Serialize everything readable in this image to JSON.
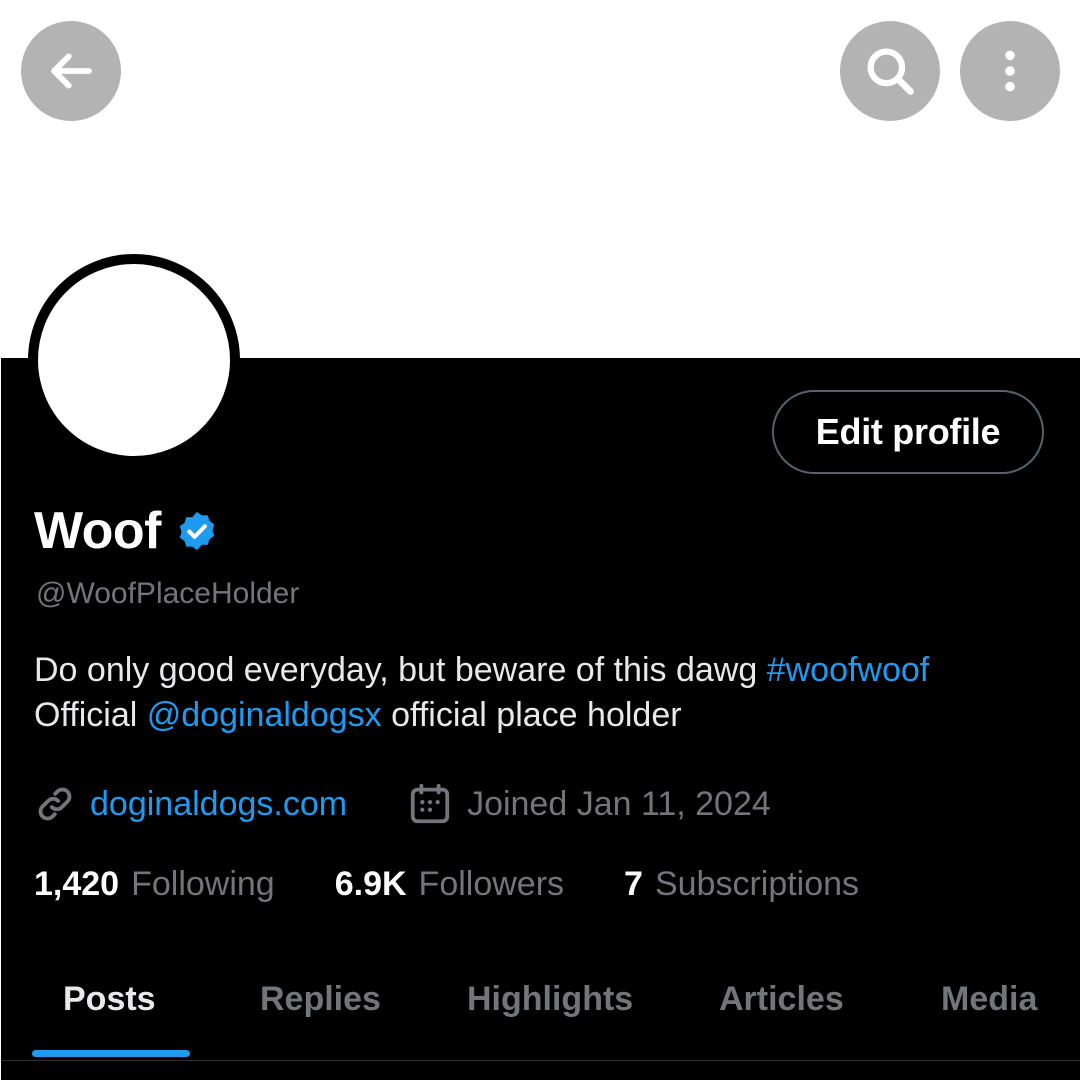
{
  "top_bar": {
    "back_icon": "arrow-left-icon",
    "search_icon": "search-icon",
    "more_icon": "more-vertical-icon"
  },
  "profile": {
    "display_name": "Woof",
    "verified_icon": "verified-badge-icon",
    "handle": "@WoofPlaceHolder",
    "edit_label": "Edit profile",
    "bio_line1_text": "Do only good everyday, but beware of this dawg ",
    "bio_hashtag": "#woofwoof",
    "bio_line2_prefix": "Official ",
    "bio_mention": "@doginaldogsx",
    "bio_line2_suffix": " official place holder",
    "website_icon": "link-icon",
    "website": "doginaldogs.com",
    "joined_icon": "calendar-icon",
    "joined": "Joined Jan 11, 2024"
  },
  "stats": [
    {
      "count": "1,420",
      "label": "Following"
    },
    {
      "count": "6.9K",
      "label": "Followers"
    },
    {
      "count": "7",
      "label": "Subscriptions"
    }
  ],
  "tabs": [
    {
      "label": "Posts",
      "active": true
    },
    {
      "label": "Replies",
      "active": false
    },
    {
      "label": "Highlights",
      "active": false
    },
    {
      "label": "Articles",
      "active": false
    },
    {
      "label": "Media",
      "active": false
    }
  ],
  "colors": {
    "accent": "#1d9bf0",
    "background": "#000000",
    "muted_text": "#71767b",
    "overlay_button": "#b3b3b3"
  }
}
